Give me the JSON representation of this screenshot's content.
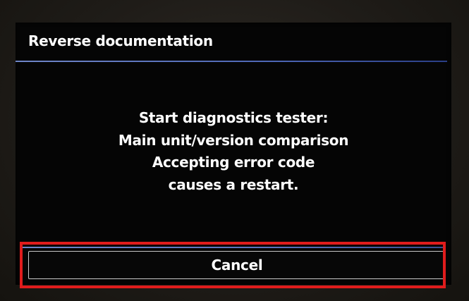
{
  "dialog": {
    "title": "Reverse documentation",
    "message_lines": [
      "Start diagnostics tester:",
      "Main unit/version comparison",
      "Accepting error code",
      "causes a restart."
    ],
    "cancel_label": "Cancel"
  },
  "colors": {
    "highlight": "#e01c1c",
    "accent_rule": "#5a72bd",
    "screen_background": "#050505",
    "text": "#ffffff"
  }
}
